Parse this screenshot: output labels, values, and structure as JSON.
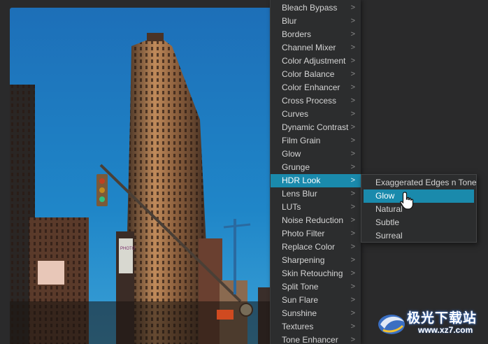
{
  "menu": {
    "items": [
      {
        "label": "Bleach Bypass"
      },
      {
        "label": "Blur"
      },
      {
        "label": "Borders"
      },
      {
        "label": "Channel Mixer"
      },
      {
        "label": "Color Adjustment"
      },
      {
        "label": "Color Balance"
      },
      {
        "label": "Color Enhancer"
      },
      {
        "label": "Cross Process"
      },
      {
        "label": "Curves"
      },
      {
        "label": "Dynamic Contrast"
      },
      {
        "label": "Film Grain"
      },
      {
        "label": "Glow"
      },
      {
        "label": "Grunge"
      },
      {
        "label": "HDR Look"
      },
      {
        "label": "Lens Blur"
      },
      {
        "label": "LUTs"
      },
      {
        "label": "Noise Reduction"
      },
      {
        "label": "Photo Filter"
      },
      {
        "label": "Replace Color"
      },
      {
        "label": "Sharpening"
      },
      {
        "label": "Skin Retouching"
      },
      {
        "label": "Split Tone"
      },
      {
        "label": "Sun Flare"
      },
      {
        "label": "Sunshine"
      },
      {
        "label": "Textures"
      },
      {
        "label": "Tone Enhancer"
      }
    ],
    "active_item": "HDR Look",
    "chevron_glyph": ">"
  },
  "submenu": {
    "items": [
      {
        "label": "Exaggerated Edges n Tone"
      },
      {
        "label": "Glow"
      },
      {
        "label": "Natural"
      },
      {
        "label": "Subtle"
      },
      {
        "label": "Surreal"
      }
    ],
    "hovered_item": "Glow"
  },
  "photo": {
    "sign_text": "PHOTO"
  },
  "watermark": {
    "title": "极光下载站",
    "url": "www.xz7.com"
  },
  "colors": {
    "accent": "#1a8aac",
    "menu_bg": "#2c2d2e",
    "app_bg": "#2a2a2b",
    "sky": "#1f78bf"
  }
}
